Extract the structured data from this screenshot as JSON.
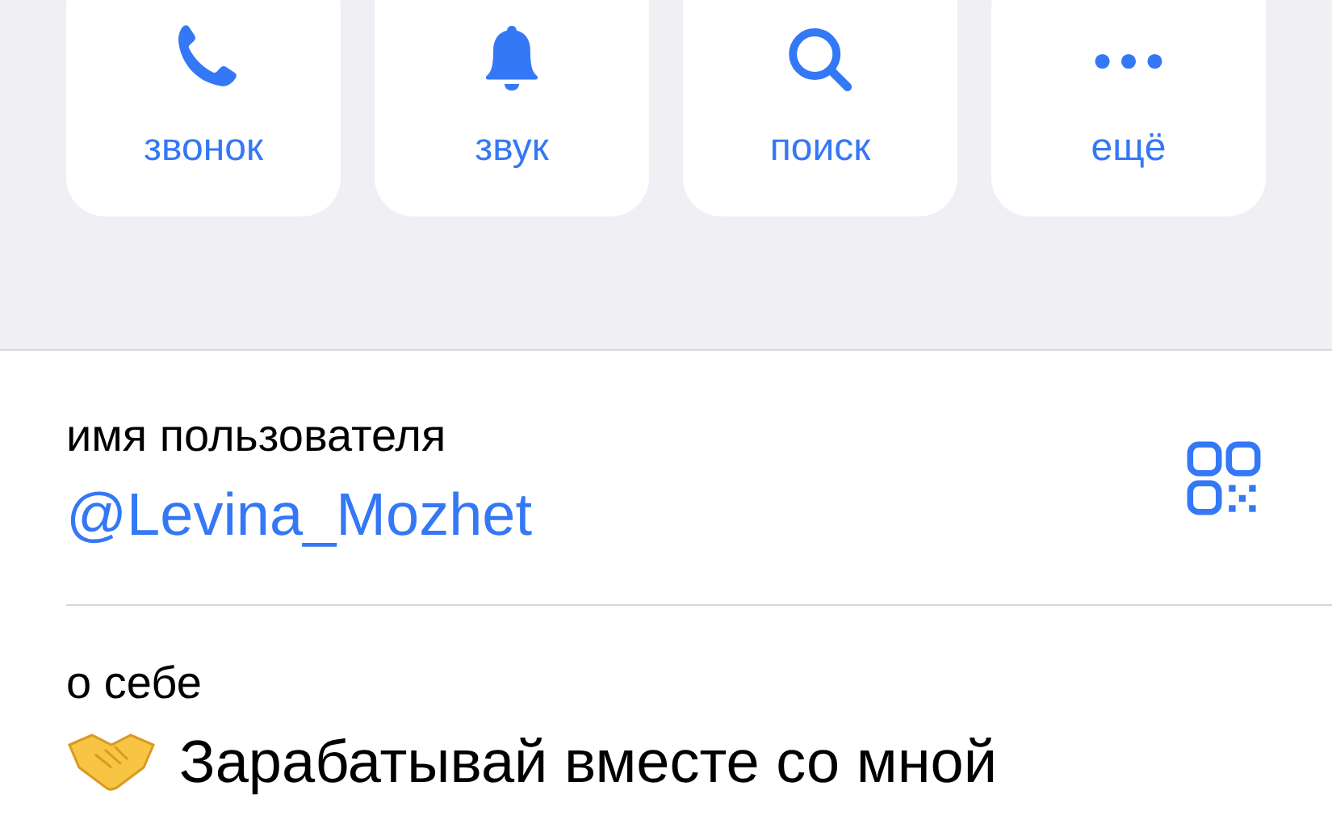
{
  "actions": [
    {
      "kind": "call",
      "label": "звонок"
    },
    {
      "kind": "sound",
      "label": "звук"
    },
    {
      "kind": "search",
      "label": "поиск"
    },
    {
      "kind": "more",
      "label": "ещё"
    }
  ],
  "username": {
    "label": "имя пользователя",
    "value": "@Levina_Mozhet"
  },
  "bio": {
    "label": "о себе",
    "text": "Зарабатывай вместе со мной"
  }
}
